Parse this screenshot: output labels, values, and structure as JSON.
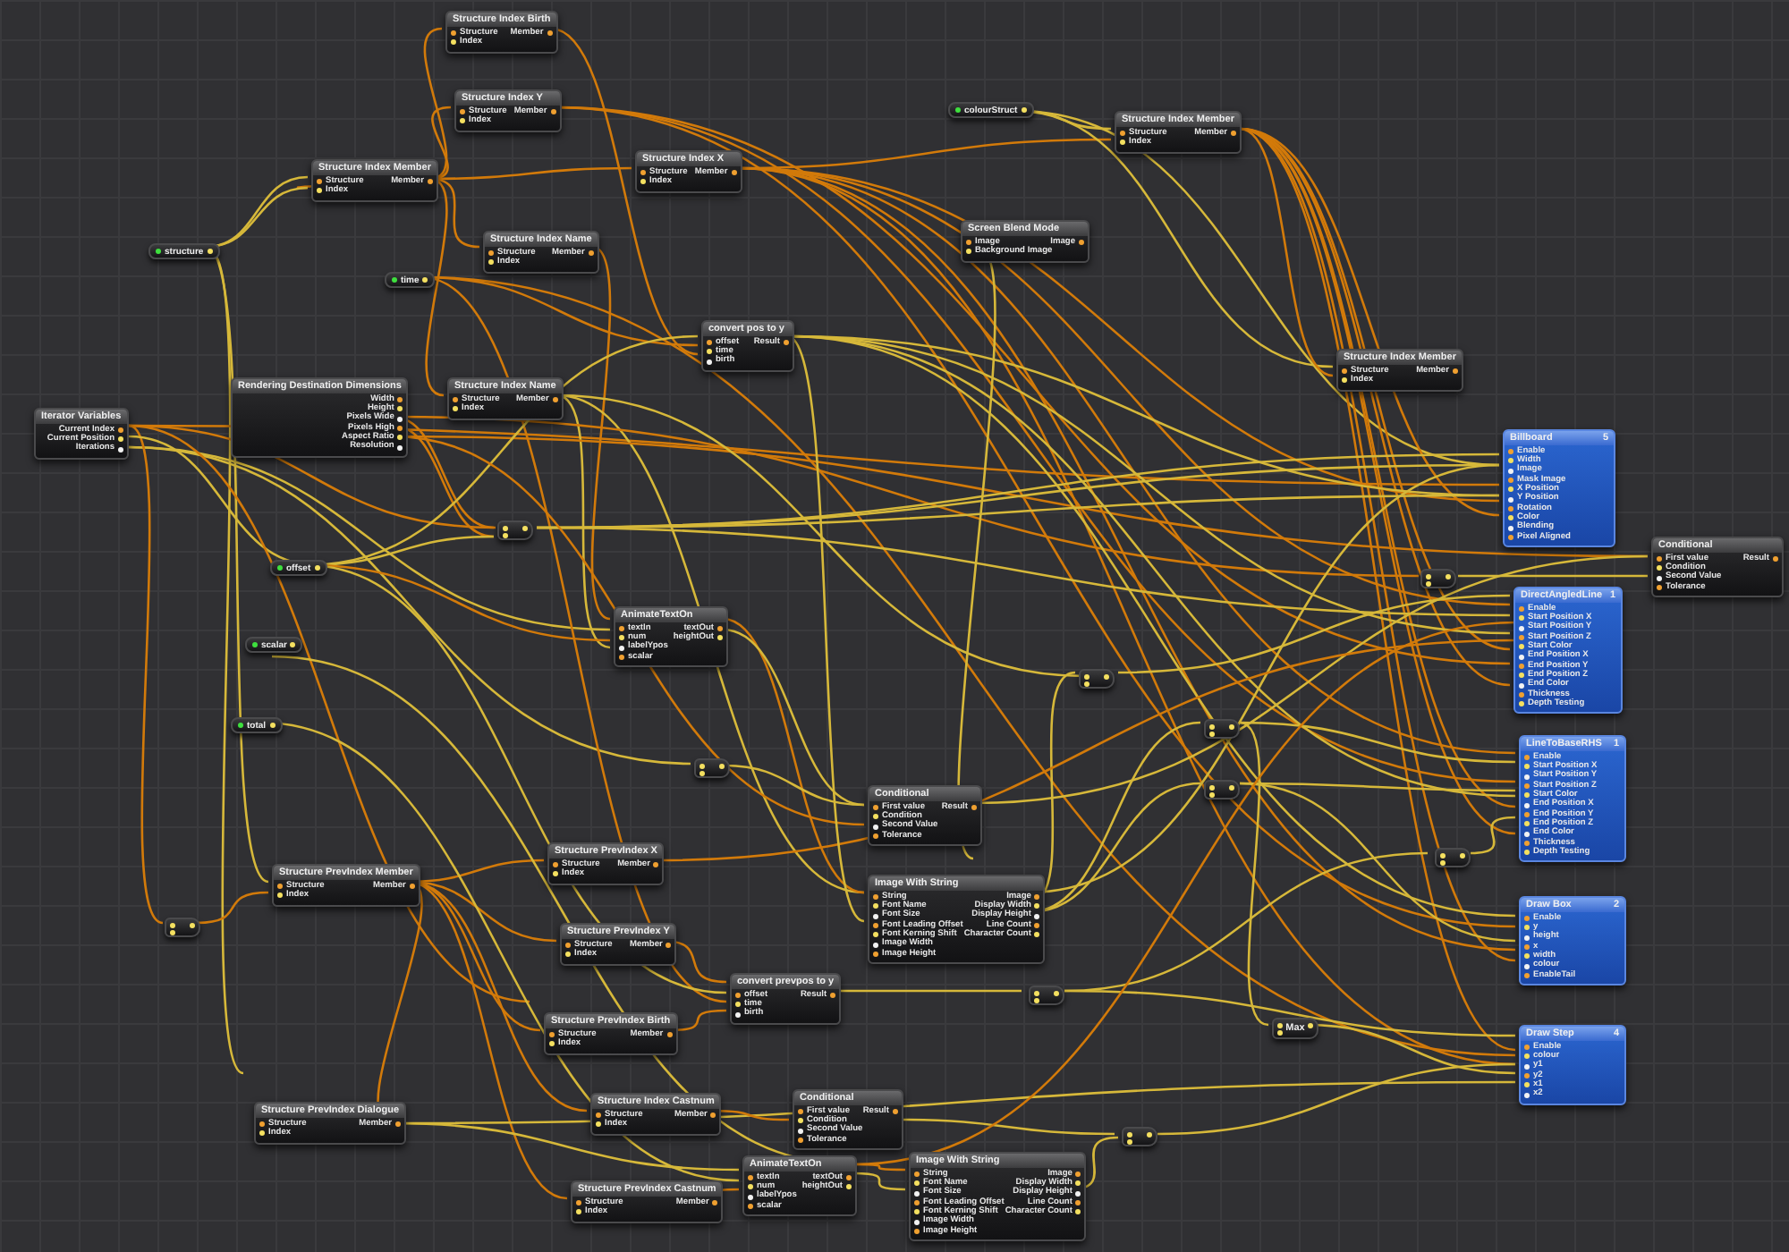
{
  "nodes": [
    {
      "kind": "patch",
      "title": "Structure Index Birth",
      "inputs": [
        "Structure",
        "Index"
      ],
      "outputs": [
        "Member"
      ]
    },
    {
      "kind": "patch",
      "title": "Structure Index Y",
      "inputs": [
        "Structure",
        "Index"
      ],
      "outputs": [
        "Member"
      ]
    },
    {
      "kind": "input",
      "title": "colourStruct"
    },
    {
      "kind": "patch",
      "title": "Structure Index Member",
      "inputs": [
        "Structure",
        "Index"
      ],
      "outputs": [
        "Member"
      ]
    },
    {
      "kind": "patch",
      "title": "Structure Index Member",
      "inputs": [
        "Structure",
        "Index"
      ],
      "outputs": [
        "Member"
      ]
    },
    {
      "kind": "patch",
      "title": "Structure Index X",
      "inputs": [
        "Structure",
        "Index"
      ],
      "outputs": [
        "Member"
      ]
    },
    {
      "kind": "input",
      "title": "structure"
    },
    {
      "kind": "patch",
      "title": "Structure Index Name",
      "inputs": [
        "Structure",
        "Index"
      ],
      "outputs": [
        "Member"
      ]
    },
    {
      "kind": "patch",
      "title": "Screen Blend Mode",
      "inputs": [
        "Image",
        "Background Image"
      ],
      "outputs": [
        "Image"
      ]
    },
    {
      "kind": "input",
      "title": "time"
    },
    {
      "kind": "patch",
      "title": "convert pos to y",
      "inputs": [
        "offset",
        "time",
        "birth"
      ],
      "outputs": [
        "Result"
      ]
    },
    {
      "kind": "patch",
      "title": "Structure Index Member",
      "inputs": [
        "Structure",
        "Index"
      ],
      "outputs": [
        "Member"
      ]
    },
    {
      "kind": "patch",
      "title": "Iterator Variables",
      "outputs": [
        "Current Index",
        "Current Position",
        "Iterations"
      ]
    },
    {
      "kind": "patch",
      "title": "Rendering Destination Dimensions",
      "outputs": [
        "Width",
        "Height",
        "Pixels Wide",
        "Pixels High",
        "Aspect Ratio",
        "Resolution"
      ]
    },
    {
      "kind": "patch",
      "title": "Structure Index Name",
      "inputs": [
        "Structure",
        "Index"
      ],
      "outputs": [
        "Member"
      ]
    },
    {
      "kind": "operator"
    },
    {
      "kind": "renderer",
      "title": "Billboard",
      "layer": "5",
      "inputs": [
        "Enable",
        "Width",
        "Image",
        "Mask Image",
        "X Position",
        "Y Position",
        "Rotation",
        "Color",
        "Blending",
        "Pixel Aligned"
      ]
    },
    {
      "kind": "input",
      "title": "offset"
    },
    {
      "kind": "operator"
    },
    {
      "kind": "patch",
      "title": "Conditional",
      "inputs": [
        "First value",
        "Condition",
        "Second Value",
        "Tolerance"
      ],
      "outputs": [
        "Result"
      ]
    },
    {
      "kind": "input",
      "title": "scalar"
    },
    {
      "kind": "patch",
      "title": "AnimateTextOn",
      "inputs": [
        "textIn",
        "num",
        "labelYpos",
        "scalar"
      ],
      "outputs": [
        "textOut",
        "heightOut"
      ]
    },
    {
      "kind": "operator"
    },
    {
      "kind": "renderer",
      "title": "DirectAngledLine",
      "layer": "1",
      "inputs": [
        "Enable",
        "Start Position X",
        "Start Position Y",
        "Start Position Z",
        "Start Color",
        "End Position X",
        "End Position Y",
        "End Position Z",
        "End Color",
        "Thickness",
        "Depth Testing"
      ]
    },
    {
      "kind": "input",
      "title": "total"
    },
    {
      "kind": "operator"
    },
    {
      "kind": "operator"
    },
    {
      "kind": "operator"
    },
    {
      "kind": "patch",
      "title": "Conditional",
      "inputs": [
        "First value",
        "Condition",
        "Second Value",
        "Tolerance"
      ],
      "outputs": [
        "Result"
      ]
    },
    {
      "kind": "renderer",
      "title": "LineToBaseRHS",
      "layer": "1",
      "inputs": [
        "Enable",
        "Start Position X",
        "Start Position Y",
        "Start Position Z",
        "Start Color",
        "End Position X",
        "End Position Y",
        "End Position Z",
        "End Color",
        "Thickness",
        "Depth Testing"
      ]
    },
    {
      "kind": "patch",
      "title": "Structure PrevIndex X",
      "inputs": [
        "Structure",
        "Index"
      ],
      "outputs": [
        "Member"
      ]
    },
    {
      "kind": "operator"
    },
    {
      "kind": "patch",
      "title": "Structure PrevIndex Member",
      "inputs": [
        "Structure",
        "Index"
      ],
      "outputs": [
        "Member"
      ]
    },
    {
      "kind": "operator"
    },
    {
      "kind": "patch",
      "title": "Structure PrevIndex Y",
      "inputs": [
        "Structure",
        "Index"
      ],
      "outputs": [
        "Member"
      ]
    },
    {
      "kind": "patch",
      "title": "Image With String",
      "inputs": [
        "String",
        "Font Name",
        "Font Size",
        "Font Leading Offset",
        "Font Kerning Shift",
        "Image Width",
        "Image Height"
      ],
      "outputs": [
        "Image",
        "Display Width",
        "Display Height",
        "Line Count",
        "Character Count"
      ]
    },
    {
      "kind": "renderer",
      "title": "Draw Box",
      "layer": "2",
      "inputs": [
        "Enable",
        "y",
        "height",
        "x",
        "width",
        "colour",
        "EnableTail"
      ]
    },
    {
      "kind": "patch",
      "title": "convert prevpos to y",
      "inputs": [
        "offset",
        "time",
        "birth"
      ],
      "outputs": [
        "Result"
      ]
    },
    {
      "kind": "operator"
    },
    {
      "kind": "patch",
      "title": "Structure PrevIndex Birth",
      "inputs": [
        "Structure",
        "Index"
      ],
      "outputs": [
        "Member"
      ]
    },
    {
      "kind": "operator",
      "title": "Max"
    },
    {
      "kind": "patch",
      "title": "Structure PrevIndex Dialogue",
      "inputs": [
        "Structure",
        "Index"
      ],
      "outputs": [
        "Member"
      ]
    },
    {
      "kind": "patch",
      "title": "Structure Index Castnum",
      "inputs": [
        "Structure",
        "Index"
      ],
      "outputs": [
        "Member"
      ]
    },
    {
      "kind": "renderer",
      "title": "Draw Step",
      "layer": "4",
      "inputs": [
        "Enable",
        "colour",
        "y1",
        "y2",
        "x1",
        "x2"
      ]
    },
    {
      "kind": "patch",
      "title": "Conditional",
      "inputs": [
        "First value",
        "Condition",
        "Second Value",
        "Tolerance"
      ],
      "outputs": [
        "Result"
      ]
    },
    {
      "kind": "operator"
    },
    {
      "kind": "patch",
      "title": "Structure PrevIndex Castnum",
      "inputs": [
        "Structure",
        "Index"
      ],
      "outputs": [
        "Member"
      ]
    },
    {
      "kind": "patch",
      "title": "AnimateTextOn",
      "inputs": [
        "textIn",
        "num",
        "labelYpos",
        "scalar"
      ],
      "outputs": [
        "textOut",
        "heightOut"
      ]
    },
    {
      "kind": "patch",
      "title": "Image With String",
      "inputs": [
        "String",
        "Font Name",
        "Font Size",
        "Font Leading Offset",
        "Font Kerning Shift",
        "Image Width",
        "Image Height"
      ],
      "outputs": [
        "Image",
        "Display Width",
        "Display Height",
        "Line Count",
        "Character Count"
      ]
    }
  ]
}
